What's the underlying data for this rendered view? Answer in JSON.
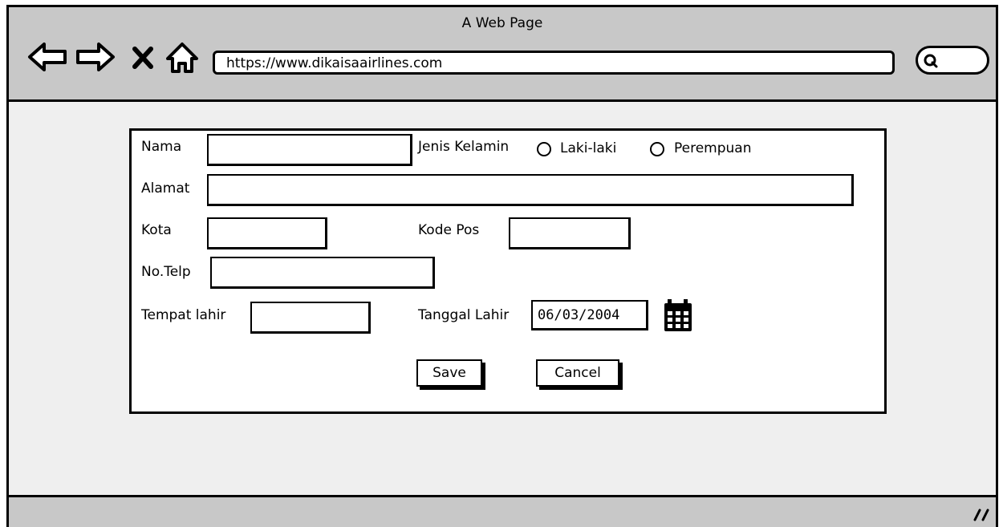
{
  "browser": {
    "title": "A Web Page",
    "url": "https://www.dikaisaairlines.com",
    "icons": [
      "back-arrow-icon",
      "forward-arrow-icon",
      "close-icon",
      "home-icon",
      "search-icon",
      "resize-grip-icon"
    ]
  },
  "form": {
    "nama_label": "Nama",
    "nama_value": "",
    "gender_label": "Jenis Kelamin",
    "gender_options": [
      "Laki-laki",
      "Perempuan"
    ],
    "alamat_label": "Alamat",
    "alamat_value": "",
    "kota_label": "Kota",
    "kota_value": "",
    "kodepos_label": "Kode Pos",
    "kodepos_value": "",
    "telp_label": "No.Telp",
    "telp_value": "",
    "tempat_label": "Tempat lahir",
    "tempat_value": "",
    "tanggal_label": "Tanggal Lahir",
    "tanggal_value": "06/03/2004",
    "save_label": "Save",
    "cancel_label": "Cancel"
  }
}
